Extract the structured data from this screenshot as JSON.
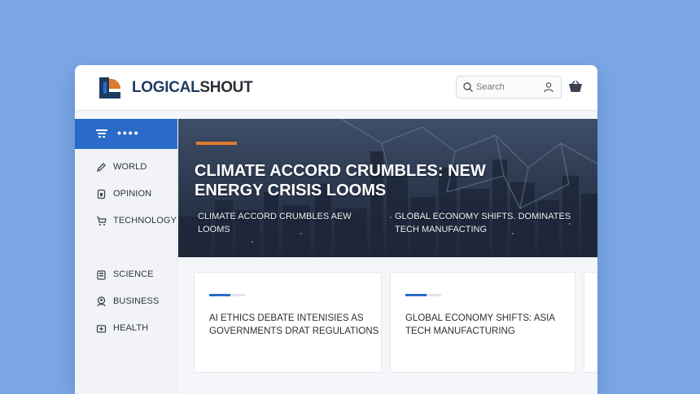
{
  "header": {
    "brand_first": "LOGICAL",
    "brand_second": "SHOUT",
    "search_placeholder": "Search"
  },
  "sidebar": {
    "active_label": "••••",
    "items": [
      {
        "label": "WORLD",
        "icon": "pen-icon"
      },
      {
        "label": "OPINION",
        "icon": "document-icon"
      },
      {
        "label": "TECHNOLOGY",
        "icon": "cart-icon"
      },
      {
        "label": "SCIENCE",
        "icon": "clipboard-icon"
      },
      {
        "label": "BUSINESS",
        "icon": "people-icon"
      },
      {
        "label": "HEALTH",
        "icon": "health-icon"
      }
    ]
  },
  "hero": {
    "title": "CLIMATE ACCORD CRUMBLES: NEW ENERGY CRISIS LOOMS",
    "sub_left": "CLIMATE ACCORD CRUMBLES AEW LOOMS",
    "sub_right": "GLOBAL ECONOMY SHIFTS. DOMINATES TECH MANUFACTING"
  },
  "cards": [
    {
      "title": "AI ETHICS DEBATE INTENISIES AS GOVERNMENTS DRAT REGULATIONS"
    },
    {
      "title": "GLOBAL ECONOMY SHIFTS: ASIA TECH MANUFACTURING"
    }
  ],
  "colors": {
    "background": "#7ba7e6",
    "accent_blue": "#2a6bc9",
    "accent_orange": "#e07a2c",
    "brand_navy": "#1f3b63"
  }
}
